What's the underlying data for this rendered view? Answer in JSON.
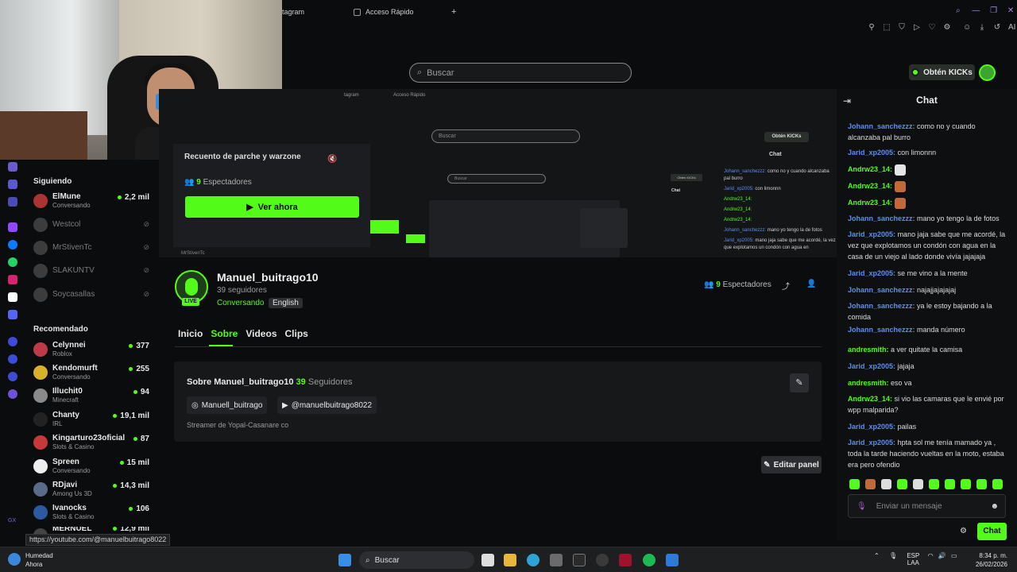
{
  "browser": {
    "tabs": [
      {
        "label": "tagram"
      },
      {
        "label": "Acceso Rápido"
      }
    ],
    "new_tab": "+",
    "ai_label": "AI"
  },
  "header": {
    "search_placeholder": "Buscar",
    "kicks_label": "Obtén KICKs"
  },
  "sidebar": {
    "following_title": "Siguiendo",
    "recommended_title": "Recomendado",
    "following": [
      {
        "name": "ElMune",
        "sub": "Conversando",
        "viewers": "2,2 mil",
        "live": true
      },
      {
        "name": "Westcol",
        "sub": "",
        "viewers": "",
        "live": false
      },
      {
        "name": "MrStivenTc",
        "sub": "",
        "viewers": "",
        "live": false
      },
      {
        "name": "SLAKUNTV",
        "sub": "",
        "viewers": "",
        "live": false
      },
      {
        "name": "Soycasallas",
        "sub": "",
        "viewers": "",
        "live": false
      }
    ],
    "recommended": [
      {
        "name": "Celynnei",
        "sub": "Roblox",
        "viewers": "377"
      },
      {
        "name": "Kendomurft",
        "sub": "Conversando",
        "viewers": "255"
      },
      {
        "name": "Illuchit0",
        "sub": "Minecraft",
        "viewers": "94"
      },
      {
        "name": "Chanty",
        "sub": "IRL",
        "viewers": "19,1 mil"
      },
      {
        "name": "Kingarturo23oficial",
        "sub": "Slots & Casino",
        "viewers": "87"
      },
      {
        "name": "Spreen",
        "sub": "Conversando",
        "viewers": "15 mil"
      },
      {
        "name": "RDjavi",
        "sub": "Among Us 3D",
        "viewers": "14,3 mil"
      },
      {
        "name": "Ivanocks",
        "sub": "Slots & Casino",
        "viewers": "106"
      },
      {
        "name": "MERNUEL",
        "sub": "",
        "viewers": "12,9 mil"
      }
    ]
  },
  "preview": {
    "stream_title": "Recuento de parche y warzone",
    "spectators_count": "9",
    "spectators_label": "Espectadores",
    "watch_label": "Ver ahora",
    "inner_tab_1": "tagram",
    "inner_tab_2": "Acceso Rápido",
    "inner_search": "Buscar",
    "inner_kicks": "Obtén KICKs",
    "inner_chat": "Chat",
    "inner_chat_lines": [
      {
        "user": "Johann_sanchezzz:",
        "text": "como no y cuando alcanzaba pal burro",
        "c": "u1"
      },
      {
        "user": "Jarid_xp2005:",
        "text": "con limonnn",
        "c": "u1"
      },
      {
        "user": "Andrw23_14:",
        "text": "",
        "c": "u2"
      },
      {
        "user": "Andrw23_14:",
        "text": "",
        "c": "u2"
      },
      {
        "user": "Andrw23_14:",
        "text": "",
        "c": "u2"
      },
      {
        "user": "Johann_sanchezzz:",
        "text": "mano yo tengo la de fotos",
        "c": "u1"
      },
      {
        "user": "Jarid_xp2005:",
        "text": "mano jaja sabe que me acordé, la vez que explotamos un condón con agua en",
        "c": "u1"
      }
    ],
    "inner_user": "MrStivenTc"
  },
  "channel": {
    "name": "Manuel_buitrago10",
    "followers": "39 seguidores",
    "category": "Conversando",
    "language": "English",
    "live_badge": "LIVE",
    "spectators_count": "9",
    "spectators_label": "Espectadores"
  },
  "tabs": [
    {
      "label": "Inicio",
      "active": false
    },
    {
      "label": "Sobre",
      "active": true
    },
    {
      "label": "Videos",
      "active": false
    },
    {
      "label": "Clips",
      "active": false
    }
  ],
  "about": {
    "title": "Sobre Manuel_buitrago10",
    "followers_count": "39",
    "followers_label": "Seguidores",
    "instagram": "Manuell_buitrago",
    "youtube": "@manuelbuitrago8022",
    "description": "Streamer de Yopal-Casanare co",
    "edit_panel": "Editar panel"
  },
  "chat": {
    "title": "Chat",
    "messages": [
      {
        "user": "Johann_sanchezzz:",
        "text": "como no y cuando alcanzaba pal burro",
        "color": "#5d8df6"
      },
      {
        "user": "Jarid_xp2005:",
        "text": "con limonnn",
        "color": "#5d8df6"
      },
      {
        "user": "Andrw23_14:",
        "text": "",
        "color": "#53fc18",
        "emote": "#e5e5e5"
      },
      {
        "user": "Andrw23_14:",
        "text": "",
        "color": "#53fc18",
        "emote": "#c2693c"
      },
      {
        "user": "Andrw23_14:",
        "text": "",
        "color": "#53fc18",
        "emote": "#c2693c"
      },
      {
        "user": "Johann_sanchezzz:",
        "text": "mano yo tengo la de fotos",
        "color": "#5d8df6"
      },
      {
        "user": "Jarid_xp2005:",
        "text": "mano jaja sabe que me acordé, la vez que explotamos un condón con agua en la casa de un viejo al lado donde vivía jajajaja",
        "color": "#5d8df6"
      },
      {
        "user": "Jarid_xp2005:",
        "text": "se me vino a la mente",
        "color": "#5d8df6"
      },
      {
        "user": "Johann_sanchezzz:",
        "text": "najajjajajajaj",
        "color": "#5d8df6"
      },
      {
        "user": "Johann_sanchezzz:",
        "text": "ya le estoy bajando a la comida",
        "color": "#5d8df6"
      },
      {
        "user": "Johann_sanchezzz:",
        "text": "manda número",
        "color": "#5d8df6"
      },
      {
        "user": "andresmith:",
        "text": "a ver quitate la camisa",
        "color": "#53fc18"
      },
      {
        "user": "Jarid_xp2005:",
        "text": "jajaja",
        "color": "#5d8df6"
      },
      {
        "user": "andresmith:",
        "text": "eso va",
        "color": "#53fc18"
      },
      {
        "user": "Andrw23_14:",
        "text": "si vio las camaras que le envié por wpp malparida?",
        "color": "#53fc18"
      },
      {
        "user": "Jarid_xp2005:",
        "text": "pailas",
        "color": "#5d8df6"
      },
      {
        "user": "Jarid_xp2005:",
        "text": "hpta sol me tenía mamado ya , toda la tarde haciendo vueltas en la moto, estaba era pero ofendio",
        "color": "#5d8df6"
      }
    ],
    "input_placeholder": "Enviar un mensaje",
    "send_label": "Chat"
  },
  "status_url": "https://youtube.com/@manuelbuitrago8022",
  "taskbar": {
    "weather_title": "Humedad",
    "weather_sub": "Ahora",
    "search_label": "Buscar",
    "lang_top": "ESP",
    "lang_bottom": "LAA",
    "time": "8:34 p. m.",
    "date": "26/02/2026"
  },
  "colors": {
    "accent": "#53fc18",
    "user_blue": "#5d8df6",
    "background": "#0b0c0d"
  }
}
